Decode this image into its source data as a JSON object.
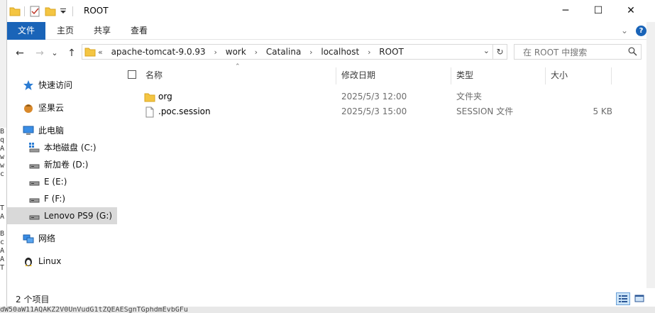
{
  "background": {
    "left_strip": [
      "B",
      "q",
      "A",
      "w",
      "w",
      "c",
      "",
      "",
      "",
      "T",
      "A",
      "",
      "B",
      "c",
      "A",
      "A",
      "T"
    ],
    "bottom_text": "dW50aW11AQAKZ2V0UnVudG1tZQEAESgnTGphdmEvbGFu"
  },
  "window": {
    "title": "ROOT",
    "controls": {
      "minimize": "─",
      "maximize": "☐",
      "close": "✕"
    }
  },
  "ribbon": {
    "tabs": [
      "文件",
      "主页",
      "共享",
      "查看"
    ],
    "collapse_icon": "⌄",
    "help_icon": "?"
  },
  "navigation": {
    "back": "←",
    "forward": "→",
    "recent": "⌄",
    "up": "↑",
    "breadcrumb_overflow": "«",
    "breadcrumb": [
      "apache-tomcat-9.0.93",
      "work",
      "Catalina",
      "localhost",
      "ROOT"
    ],
    "separator": "›",
    "dropdown": "⌄",
    "refresh": "↻"
  },
  "search": {
    "placeholder": "在 ROOT 中搜索",
    "icon": "search-icon"
  },
  "sidebar": {
    "items": [
      {
        "label": "快速访问",
        "icon": "star-icon"
      },
      {
        "label": "坚果云",
        "icon": "nut-icon"
      },
      {
        "label": "此电脑",
        "icon": "computer-icon"
      },
      {
        "label": "本地磁盘 (C:)",
        "icon": "system-drive-icon"
      },
      {
        "label": "新加卷 (D:)",
        "icon": "drive-icon"
      },
      {
        "label": "E (E:)",
        "icon": "drive-icon"
      },
      {
        "label": "F (F:)",
        "icon": "drive-icon"
      },
      {
        "label": "Lenovo PS9 (G:)",
        "icon": "drive-icon",
        "selected": true
      },
      {
        "label": "网络",
        "icon": "network-icon"
      },
      {
        "label": "Linux",
        "icon": "linux-icon"
      }
    ]
  },
  "files": {
    "columns": {
      "name": "名称",
      "date": "修改日期",
      "type": "类型",
      "size": "大小"
    },
    "rows": [
      {
        "name": "org",
        "date": "2025/5/3 12:00",
        "type": "文件夹",
        "size": "",
        "icon": "folder-icon"
      },
      {
        "name": ".poc.session",
        "date": "2025/5/3 15:00",
        "type": "SESSION 文件",
        "size": "5 KB",
        "icon": "file-icon"
      }
    ]
  },
  "status": {
    "count": "2 个项目"
  },
  "colors": {
    "accent": "#1a64b8",
    "folder": "#f4c542",
    "selected_nav": "#d9d9d9"
  }
}
